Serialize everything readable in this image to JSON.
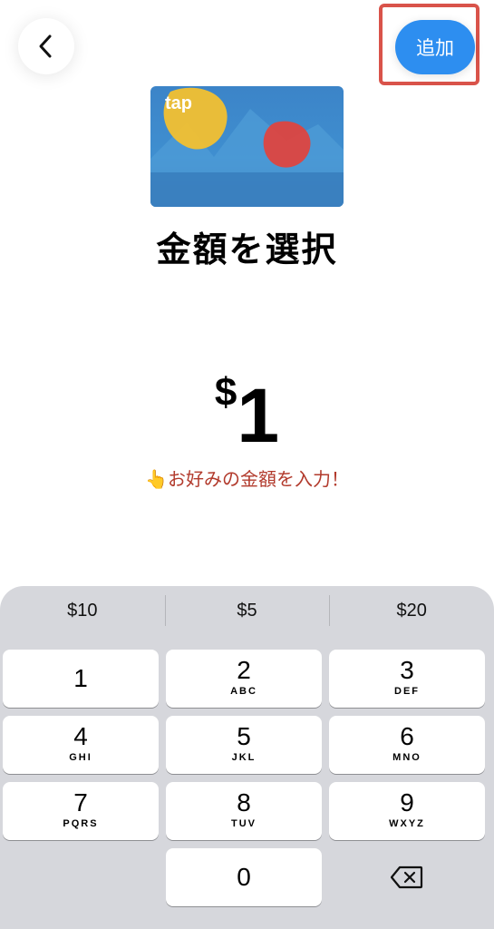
{
  "header": {
    "back_icon": "chevron-left-icon",
    "add_label": "追加",
    "add_color": "#2d8ef0",
    "highlight_color": "#d9534a"
  },
  "card": {
    "brand": "tap"
  },
  "title": "金額を選択",
  "amount": {
    "currency": "$",
    "value": "1"
  },
  "hint": "👆お好みの金額を入力！",
  "hint_color": "#b23a2c",
  "keypad": {
    "quick": [
      "$10",
      "$5",
      "$20"
    ],
    "keys": [
      {
        "num": "1",
        "letters": ""
      },
      {
        "num": "2",
        "letters": "ABC"
      },
      {
        "num": "3",
        "letters": "DEF"
      },
      {
        "num": "4",
        "letters": "GHI"
      },
      {
        "num": "5",
        "letters": "JKL"
      },
      {
        "num": "6",
        "letters": "MNO"
      },
      {
        "num": "7",
        "letters": "PQRS"
      },
      {
        "num": "8",
        "letters": "TUV"
      },
      {
        "num": "9",
        "letters": "WXYZ"
      },
      {
        "num": "0",
        "letters": ""
      }
    ],
    "delete_icon": "backspace-icon"
  }
}
